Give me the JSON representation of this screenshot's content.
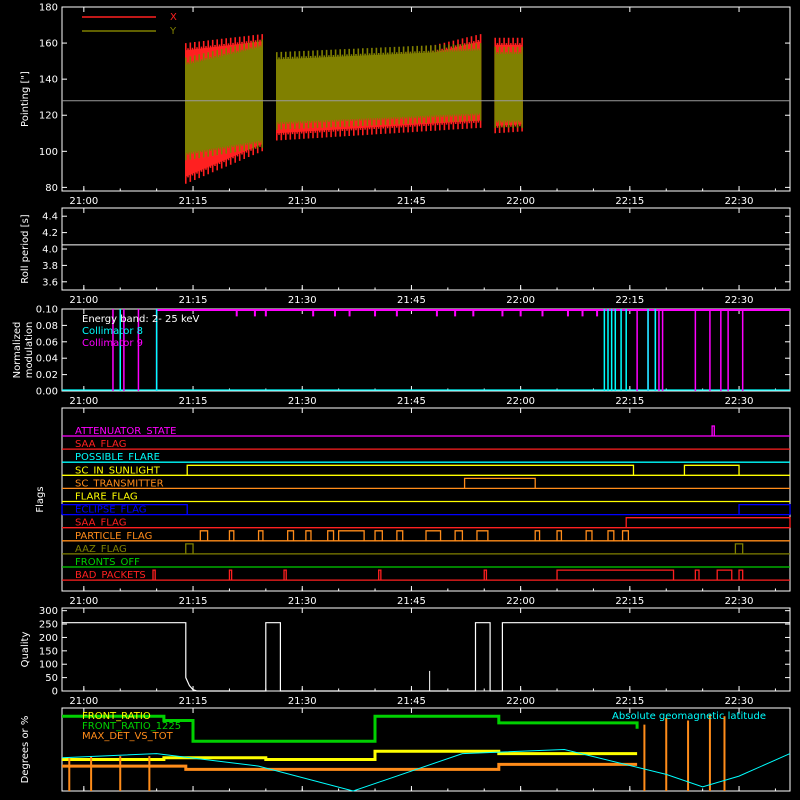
{
  "colors": {
    "background": "#000000",
    "axis": "#ffffff",
    "red": "#ff2020",
    "olive": "#808000",
    "white": "#ffffff",
    "magenta": "#ff00ff",
    "cyan": "#00ffff",
    "blue": "#0000ff",
    "yellow": "#ffff00",
    "orange": "#ff8c1a",
    "green": "#00d000",
    "dark_red": "#ff2020"
  },
  "time_axis": {
    "ticks": [
      "21:00",
      "21:15",
      "21:30",
      "21:45",
      "22:00",
      "22:15",
      "22:30"
    ],
    "tick_minutes": [
      0,
      15,
      30,
      45,
      60,
      75,
      90
    ],
    "range_minutes": [
      -3,
      97
    ]
  },
  "chart_data": [
    {
      "type": "line",
      "ylabel": "Pointing [\"]",
      "ylim": [
        78,
        180
      ],
      "yticks": [
        80,
        100,
        120,
        140,
        160,
        180
      ],
      "legend": "top-left",
      "reference_line": 128,
      "series": [
        {
          "name": "X",
          "color": "red",
          "segments": [
            {
              "x_start": 14,
              "x_end": 24.5,
              "low_start": 82,
              "low_end": 100,
              "high_start": 160,
              "high_end": 165
            },
            {
              "x_start": 26.5,
              "x_end": 54.5,
              "low_start": 106,
              "low_end": 113,
              "high_start": 138,
              "high_end": 165
            },
            {
              "x_start": 56.5,
              "x_end": 60.2,
              "low_start": 110,
              "low_end": 111,
              "high_start": 163,
              "high_end": 163
            }
          ]
        },
        {
          "name": "Y",
          "color": "olive",
          "segments": [
            {
              "x_start": 14,
              "x_end": 24.5,
              "low_start": 95,
              "low_end": 102,
              "high_start": 152,
              "high_end": 162
            },
            {
              "x_start": 26.5,
              "x_end": 54.5,
              "low_start": 112,
              "low_end": 117,
              "high_start": 155,
              "high_end": 160
            },
            {
              "x_start": 56.5,
              "x_end": 60.2,
              "low_start": 113,
              "low_end": 113,
              "high_start": 158,
              "high_end": 158
            }
          ]
        }
      ]
    },
    {
      "type": "line",
      "ylabel": "Roll period [s]",
      "ylim": [
        3.5,
        4.5
      ],
      "yticks": [
        3.6,
        3.8,
        4.0,
        4.2,
        4.4
      ],
      "series": [
        {
          "color": "white",
          "value": 4.05
        }
      ]
    },
    {
      "type": "line",
      "ylabel": "Normalized modulation",
      "ylim": [
        0,
        0.1
      ],
      "yticks": [
        "0.00",
        "0.02",
        "0.04",
        "0.06",
        "0.08",
        "0.10"
      ],
      "legend_title": "Energy band:  2- 25 keV",
      "legend": "top-left",
      "series": [
        {
          "name": "Collimator 8",
          "color": "cyan",
          "spikes": [
            5,
            10,
            71.5,
            72,
            72.5,
            73,
            73.8,
            74.5,
            77.5,
            78.5
          ]
        },
        {
          "name": "Collimator 9",
          "color": "magenta",
          "spikes": [
            4,
            5.5,
            7.5,
            10,
            76,
            77.5,
            78.5,
            79,
            79.5,
            84,
            86,
            87.5,
            88.5,
            90.5
          ],
          "top_ticks": [
            21,
            23.5,
            25,
            31.5,
            34.5,
            36.5,
            40,
            43,
            48.5,
            51,
            53.5,
            57.5,
            60,
            63,
            66.5,
            68.5,
            70.5
          ]
        }
      ]
    },
    {
      "type": "line",
      "ylabel": "Flags",
      "flags": [
        {
          "name": "ATTENUATOR_STATE",
          "color": "magenta",
          "events": [
            {
              "x": 86.3,
              "w": 0.3
            }
          ]
        },
        {
          "name": "SAA_FLAG",
          "color": "dark_red",
          "events": []
        },
        {
          "name": "POSSIBLE_FLARE",
          "color": "cyan",
          "events": []
        },
        {
          "name": "SC_IN_SUNLIGHT",
          "color": "yellow",
          "events": [
            {
              "x": 14.2,
              "w": 61.3
            },
            {
              "x": 82.5,
              "w": 7.5
            }
          ]
        },
        {
          "name": "SC_TRANSMITTER",
          "color": "orange",
          "events": [
            {
              "x": 52.3,
              "w": 9.7
            }
          ]
        },
        {
          "name": "FLARE_FLAG",
          "color": "yellow",
          "events": []
        },
        {
          "name": "ECLIPSE_FLAG",
          "color": "blue",
          "events": [
            {
              "x": -3,
              "w": 17.2
            },
            {
              "x": 90,
              "w": 7
            }
          ]
        },
        {
          "name": "SAA_FLAG",
          "color": "dark_red",
          "events": [
            {
              "x": 74.5,
              "w": 22.5
            }
          ]
        },
        {
          "name": "PARTICLE_FLAG",
          "color": "orange",
          "events": [
            {
              "x": 16,
              "w": 1
            },
            {
              "x": 20,
              "w": 0.6
            },
            {
              "x": 24,
              "w": 0.6
            },
            {
              "x": 28,
              "w": 0.8
            },
            {
              "x": 30.5,
              "w": 0.7
            },
            {
              "x": 33.5,
              "w": 0.8
            },
            {
              "x": 35,
              "w": 3.5
            },
            {
              "x": 40,
              "w": 1
            },
            {
              "x": 43,
              "w": 0.8
            },
            {
              "x": 47,
              "w": 2
            },
            {
              "x": 51,
              "w": 1
            },
            {
              "x": 54,
              "w": 1.5
            },
            {
              "x": 62,
              "w": 0.6
            },
            {
              "x": 65,
              "w": 0.6
            },
            {
              "x": 69,
              "w": 0.8
            },
            {
              "x": 72,
              "w": 0.8
            },
            {
              "x": 74,
              "w": 0.8
            }
          ]
        },
        {
          "name": "AAZ_FLAG",
          "color": "olive",
          "events": [
            {
              "x": 14,
              "w": 1
            },
            {
              "x": 89.5,
              "w": 1
            }
          ]
        },
        {
          "name": "FRONTS_OFF",
          "color": "green",
          "events": []
        },
        {
          "name": "BAD_PACKETS",
          "color": "dark_red",
          "events": [
            {
              "x": 9.5,
              "w": 0.3
            },
            {
              "x": 20,
              "w": 0.3
            },
            {
              "x": 27.5,
              "w": 0.3
            },
            {
              "x": 40.5,
              "w": 0.3
            },
            {
              "x": 55,
              "w": 0.3
            },
            {
              "x": 65,
              "w": 16
            },
            {
              "x": 84,
              "w": 0.5
            },
            {
              "x": 87,
              "w": 2
            },
            {
              "x": 90,
              "w": 0.5
            }
          ]
        }
      ]
    },
    {
      "type": "line",
      "ylabel": "Quality",
      "ylim": [
        0,
        310
      ],
      "yticks": [
        0,
        50,
        100,
        150,
        200,
        250,
        300
      ],
      "series": [
        {
          "color": "white",
          "points": [
            [
              -3,
              255
            ],
            [
              14,
              255
            ],
            [
              14,
              50
            ],
            [
              14.5,
              20
            ],
            [
              15,
              5
            ],
            [
              15.5,
              0
            ],
            [
              25,
              0
            ],
            [
              25,
              255
            ],
            [
              27,
              255
            ],
            [
              27,
              0
            ],
            [
              53.8,
              0
            ],
            [
              53.8,
              255
            ],
            [
              55.8,
              255
            ],
            [
              55.8,
              0
            ],
            [
              57.5,
              0
            ],
            [
              57.5,
              255
            ],
            [
              97,
              255
            ]
          ],
          "spikes": [
            [
              47.5,
              75
            ]
          ]
        }
      ]
    },
    {
      "type": "line",
      "ylabel": "Degrees or %",
      "ylim": [
        0,
        100
      ],
      "legend": "top-left",
      "series": [
        {
          "name": "FRONT_RATIO",
          "color": "yellow",
          "steps": [
            [
              -3,
              38
            ],
            [
              11,
              38
            ],
            [
              11,
              40
            ],
            [
              25,
              40
            ],
            [
              25,
              38
            ],
            [
              40,
              38
            ],
            [
              40,
              48
            ],
            [
              57,
              48
            ],
            [
              57,
              45
            ],
            [
              76,
              45
            ]
          ]
        },
        {
          "name": "FRONT_RATIO_1225",
          "color": "green",
          "steps": [
            [
              -3,
              90
            ],
            [
              11,
              90
            ],
            [
              11,
              85
            ],
            [
              15,
              85
            ],
            [
              15,
              60
            ],
            [
              40,
              60
            ],
            [
              40,
              90
            ],
            [
              57,
              90
            ],
            [
              57,
              82
            ],
            [
              76,
              82
            ],
            [
              76,
              75
            ]
          ]
        },
        {
          "name": "MAX_DET_VS_TOT",
          "color": "orange",
          "steps": [
            [
              -3,
              30
            ],
            [
              14,
              30
            ],
            [
              14,
              26
            ],
            [
              57,
              26
            ],
            [
              57,
              32
            ],
            [
              76,
              32
            ]
          ],
          "spikes": [
            [
              -2,
              40
            ],
            [
              1,
              42
            ],
            [
              5,
              42
            ],
            [
              9,
              42
            ],
            [
              77,
              80
            ],
            [
              80,
              88
            ],
            [
              83,
              85
            ],
            [
              86,
              92
            ],
            [
              88,
              90
            ]
          ]
        },
        {
          "name": "Absolute geomagnetic latitude",
          "color": "cyan",
          "points": [
            [
              -3,
              40
            ],
            [
              10,
              45
            ],
            [
              24,
              30
            ],
            [
              37,
              0
            ],
            [
              52,
              45
            ],
            [
              66,
              50
            ],
            [
              80,
              20
            ],
            [
              85,
              5
            ],
            [
              90,
              18
            ],
            [
              97,
              45
            ]
          ]
        }
      ]
    }
  ]
}
